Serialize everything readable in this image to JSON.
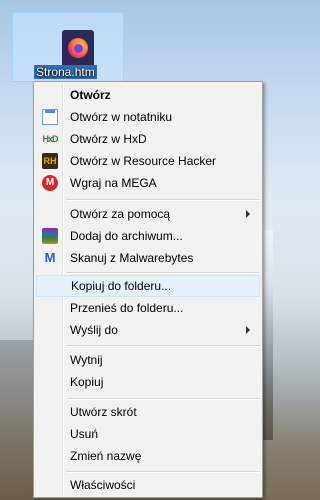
{
  "desktop": {
    "file_label": "Strona.htm"
  },
  "menu": {
    "items": [
      {
        "label": "Otwórz",
        "bold": true
      },
      {
        "label": "Otwórz w notatniku",
        "icon": "notepad-icon"
      },
      {
        "label": "Otwórz w HxD",
        "icon": "hxd-icon",
        "glyph": "HxD"
      },
      {
        "label": "Otwórz w Resource Hacker",
        "icon": "resource-hacker-icon",
        "glyph": "RH"
      },
      {
        "label": "Wgraj na MEGA",
        "icon": "mega-icon",
        "glyph": "M"
      },
      {
        "label": "Otwórz za pomocą",
        "submenu": true
      },
      {
        "label": "Dodaj do archiwum...",
        "icon": "winrar-icon"
      },
      {
        "label": "Skanuj z Malwarebytes",
        "icon": "malwarebytes-icon",
        "glyph": "M"
      },
      {
        "label": "Kopiuj do folderu...",
        "highlighted": true
      },
      {
        "label": "Przenieś do folderu..."
      },
      {
        "label": "Wyślij do",
        "submenu": true
      },
      {
        "label": "Wytnij"
      },
      {
        "label": "Kopiuj"
      },
      {
        "label": "Utwórz skrót"
      },
      {
        "label": "Usuń"
      },
      {
        "label": "Zmień nazwę"
      },
      {
        "label": "Właściwości"
      }
    ]
  },
  "colors": {
    "menu_bg": "#f2f2f2",
    "highlight": "#e5f1fb",
    "highlight_border": "#cce4f7",
    "selection_blue": "#2f6fb8"
  }
}
